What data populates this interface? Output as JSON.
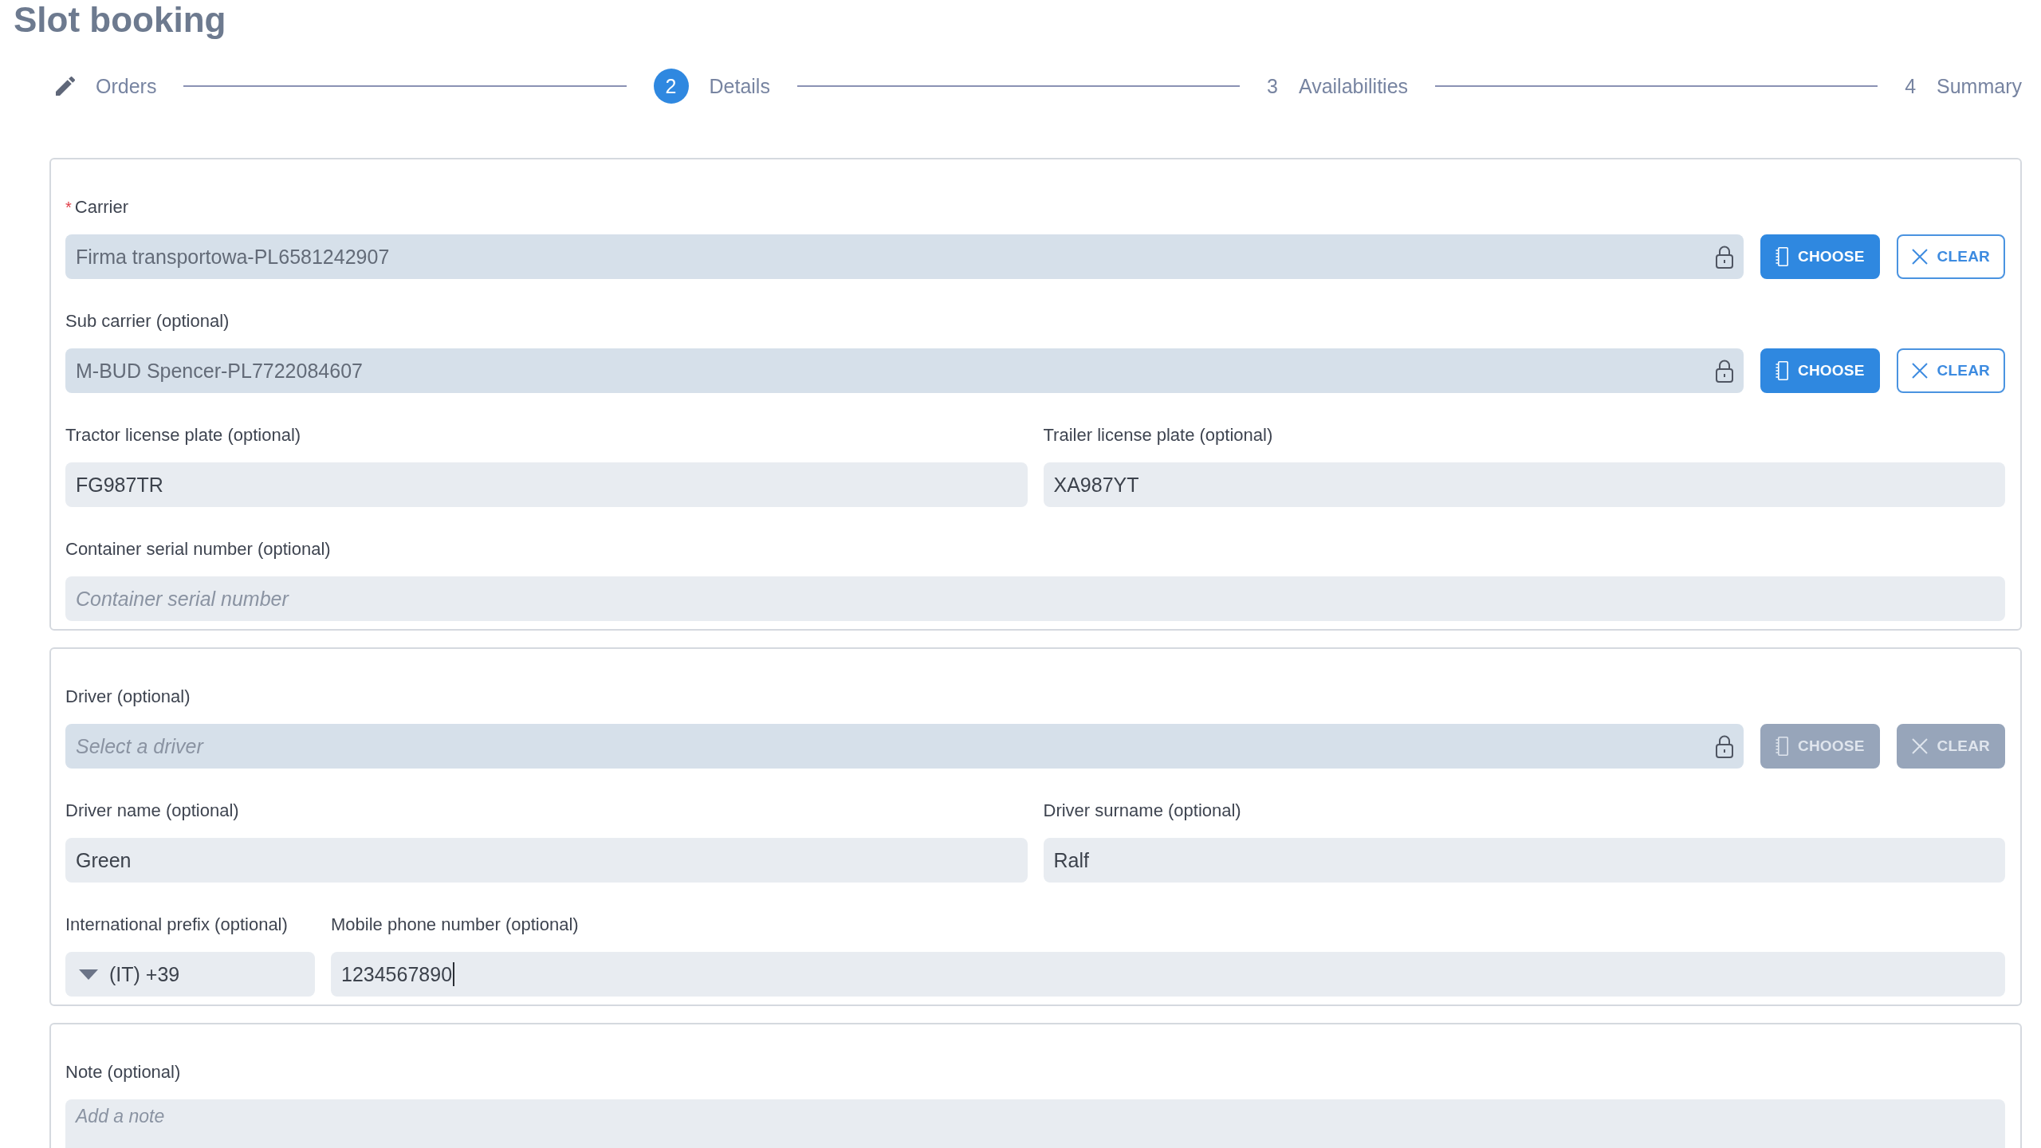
{
  "page_title": "Slot booking",
  "stepper": [
    {
      "kind": "edit",
      "label": "Orders",
      "selected": false
    },
    {
      "kind": "number",
      "number": "2",
      "label": "Details",
      "selected": true
    },
    {
      "kind": "number",
      "number": "3",
      "label": "Availabilities",
      "selected": false
    },
    {
      "kind": "number",
      "number": "4",
      "label": "Summary",
      "selected": false
    }
  ],
  "sections": [
    {
      "rows": [
        {
          "fields": [
            {
              "kind": "picker",
              "label": "Carrier",
              "required_mark": "*",
              "value": "Firma transportowa-PL6581242907",
              "locked": true,
              "choose_button": {
                "label": "CHOOSE",
                "disabled": false
              },
              "clear_button": {
                "label": "CLEAR",
                "disabled": false
              }
            }
          ]
        },
        {
          "fields": [
            {
              "kind": "picker",
              "label": "Sub carrier (optional)",
              "value": "M-BUD Spencer-PL7722084607",
              "locked": true,
              "choose_button": {
                "label": "CHOOSE",
                "disabled": false
              },
              "clear_button": {
                "label": "CLEAR",
                "disabled": false
              }
            }
          ]
        },
        {
          "fields": [
            {
              "kind": "text",
              "label": "Tractor license plate (optional)",
              "value": "FG987TR",
              "focused": false
            },
            {
              "kind": "text",
              "label": "Trailer license plate (optional)",
              "value": "XA987YT",
              "focused": false
            }
          ]
        },
        {
          "fields": [
            {
              "kind": "text",
              "label": "Container serial number (optional)",
              "placeholder": "Container serial number",
              "focused": false
            }
          ]
        }
      ]
    },
    {
      "rows": [
        {
          "fields": [
            {
              "kind": "picker",
              "label": "Driver (optional)",
              "placeholder": "Select a driver",
              "locked": true,
              "choose_button": {
                "label": "CHOOSE",
                "disabled": true
              },
              "clear_button": {
                "label": "CLEAR",
                "disabled": true
              }
            }
          ]
        },
        {
          "fields": [
            {
              "kind": "text",
              "label": "Driver name (optional)",
              "value": "Green",
              "focused": false
            },
            {
              "kind": "text",
              "label": "Driver surname (optional)",
              "value": "Ralf",
              "focused": false
            }
          ]
        },
        {
          "fields": [
            {
              "kind": "select",
              "label": "International prefix (optional)",
              "value": "(IT) +39"
            },
            {
              "kind": "text",
              "label": "Mobile phone number (optional)",
              "value": "1234567890",
              "focused": true
            }
          ]
        }
      ]
    },
    {
      "rows": [
        {
          "fields": [
            {
              "kind": "textarea",
              "label": "Note (optional)",
              "placeholder": "Add a note",
              "focused": false
            }
          ]
        }
      ]
    }
  ]
}
